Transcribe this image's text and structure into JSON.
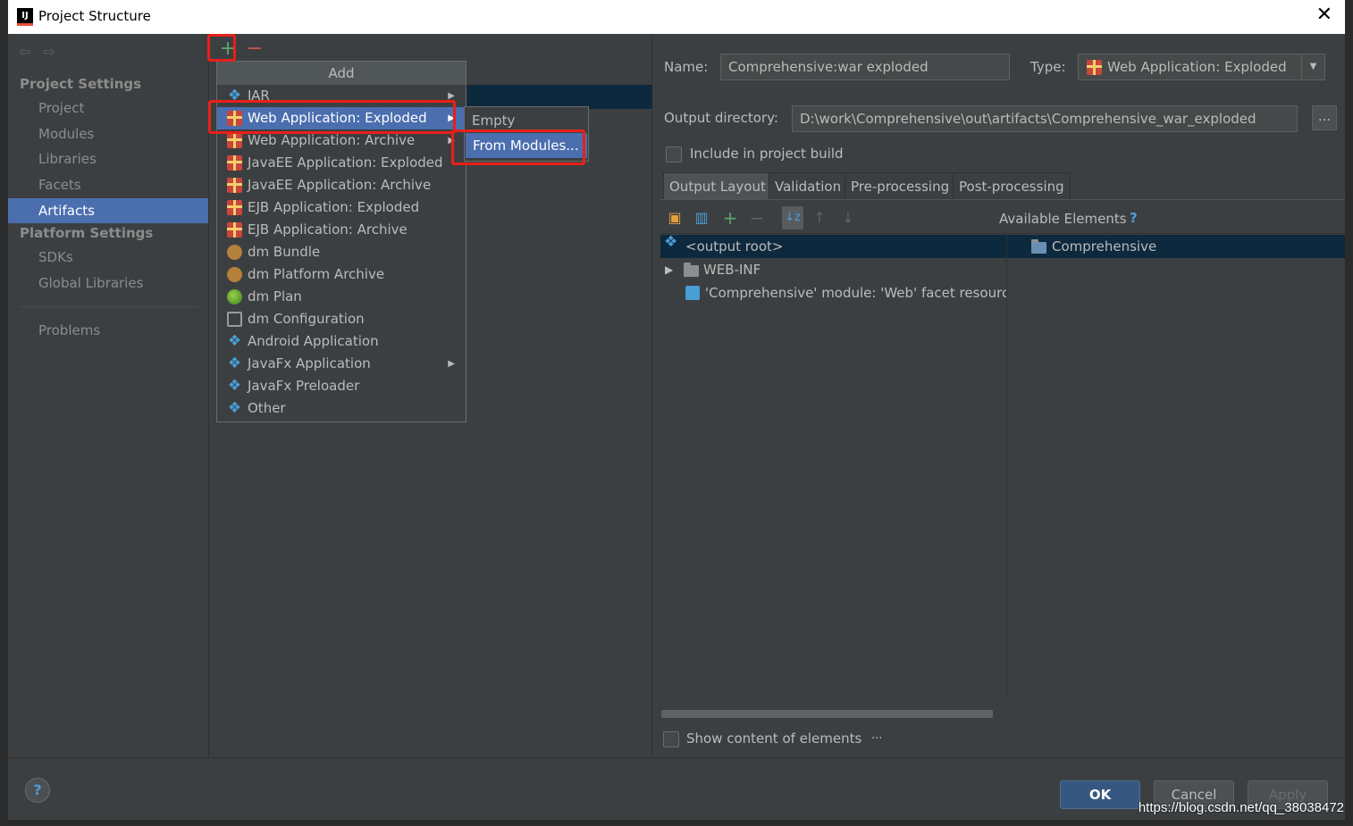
{
  "window": {
    "title": "Project Structure",
    "close": "✕"
  },
  "sidebar": {
    "nav_back": "⇦",
    "nav_forward": "⇨",
    "project_settings": "Project Settings",
    "platform_settings": "Platform Settings",
    "items": [
      "Project",
      "Modules",
      "Libraries",
      "Facets",
      "Artifacts"
    ],
    "platform_items": [
      "SDKs",
      "Global Libraries"
    ],
    "problems": "Problems",
    "selected": "Artifacts"
  },
  "toolbar": {
    "add": "+",
    "remove": "−"
  },
  "add_menu": {
    "header": "Add",
    "items": [
      {
        "label": "JAR",
        "icon": "diamond-icon",
        "has_sub": true
      },
      {
        "label": "Web Application: Exploded",
        "icon": "gift-icon",
        "has_sub": true,
        "active": true
      },
      {
        "label": "Web Application: Archive",
        "icon": "gift-icon",
        "has_sub": true
      },
      {
        "label": "JavaEE Application: Exploded",
        "icon": "gift-icon"
      },
      {
        "label": "JavaEE Application: Archive",
        "icon": "gift-icon"
      },
      {
        "label": "EJB Application: Exploded",
        "icon": "gift-icon"
      },
      {
        "label": "EJB Application: Archive",
        "icon": "gift-icon"
      },
      {
        "label": "dm Bundle",
        "icon": "bundle-icon"
      },
      {
        "label": "dm Platform Archive",
        "icon": "bundle-icon"
      },
      {
        "label": "dm Plan",
        "icon": "plan-icon"
      },
      {
        "label": "dm Configuration",
        "icon": "doc-icon"
      },
      {
        "label": "Android Application",
        "icon": "diamond-icon"
      },
      {
        "label": "JavaFx Application",
        "icon": "diamond-icon",
        "has_sub": true
      },
      {
        "label": "JavaFx Preloader",
        "icon": "diamond-icon"
      },
      {
        "label": "Other",
        "icon": "diamond-icon"
      }
    ],
    "submenu": [
      "Empty",
      "From Modules..."
    ]
  },
  "details": {
    "name_label": "Name:",
    "name_value": "Comprehensive:war exploded",
    "type_label": "Type:",
    "type_value": "Web Application: Exploded",
    "output_label": "Output directory:",
    "output_value": "D:\\work\\Comprehensive\\out\\artifacts\\Comprehensive_war_exploded",
    "browse": "...",
    "include_label": "Include in project build",
    "tabs": [
      "Output Layout",
      "Validation",
      "Pre-processing",
      "Post-processing"
    ],
    "available_elements": "Available Elements",
    "help_q": "?",
    "tree": [
      "<output root>",
      "WEB-INF",
      "'Comprehensive' module: 'Web' facet resource"
    ],
    "available_tree": [
      "Comprehensive"
    ],
    "show_content": "Show content of elements",
    "show_content_btn": "..."
  },
  "buttons": {
    "help": "?",
    "ok": "OK",
    "cancel": "Cancel",
    "apply": "Apply"
  },
  "watermark": "https://blog.csdn.net/qq_38038472",
  "colors": {
    "background": "#3c3f41",
    "selection": "#4b6eaf",
    "highlight": "#e8201a",
    "accent_green": "#59a869",
    "accent_red": "#c75450"
  }
}
